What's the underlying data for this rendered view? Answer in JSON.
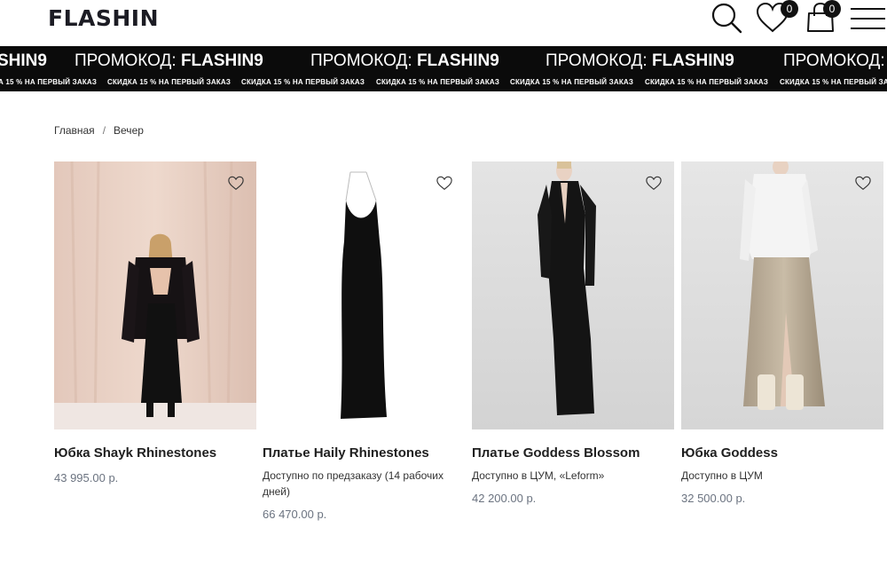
{
  "header": {
    "logo": "FLASHIN",
    "wishlist_count": "0",
    "cart_count": "0"
  },
  "promo": {
    "prefix": "ПРОМОКОД:",
    "code": "FLASHIN9",
    "partial_code": "SHIN9",
    "discount_text": "СКИДКА 15 % НА ПЕРВЫЙ ЗАКАЗ",
    "partial_discount": "А 15 % НА ПЕРВЫЙ ЗАКАЗ"
  },
  "breadcrumb": {
    "home": "Главная",
    "separator": "/",
    "current": "Вечер"
  },
  "products": [
    {
      "name": "Юбка Shayk Rhinestones",
      "availability": "",
      "price": "43 995.00 р."
    },
    {
      "name": "Платье Haily Rhinestones",
      "availability": "Доступно по предзаказу (14 рабочих дней)",
      "price": "66 470.00 р."
    },
    {
      "name": "Платье Goddess Blossom",
      "availability": "Доступно в ЦУМ, «Leform»",
      "price": "42 200.00 р."
    },
    {
      "name": "Юбка Goddess",
      "availability": "Доступно в ЦУМ",
      "price": "32 500.00 р."
    }
  ]
}
